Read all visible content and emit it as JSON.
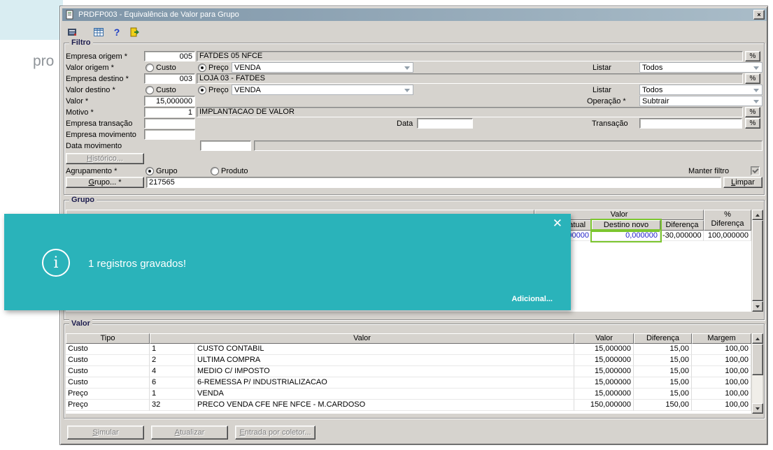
{
  "page": {
    "partial_text": "pro"
  },
  "window": {
    "title": "PRDFP003 - Equivalência de Valor para Grupo",
    "close_glyph": "×"
  },
  "icons": {
    "help_glyph": "?",
    "lookup_glyph": "%"
  },
  "colors": {
    "titlebar": "#7e95a8",
    "toast": "#2ab3ba",
    "highlight_green": "#7cc62f",
    "value_blue": "#2121c8"
  },
  "filtro": {
    "legend": "Filtro",
    "empresa_origem": {
      "label": "Empresa origem *",
      "code": "005",
      "desc": "FATDES 05 NFCE"
    },
    "valor_origem": {
      "label": "Valor origem *",
      "opt_custo": "Custo",
      "opt_preco": "Preço",
      "tipo": "VENDA",
      "listar_label": "Listar",
      "listar": "Todos"
    },
    "empresa_destino": {
      "label": "Empresa destino *",
      "code": "003",
      "desc": "LOJA 03 - FATDES"
    },
    "valor_destino": {
      "label": "Valor destino *",
      "opt_custo": "Custo",
      "opt_preco": "Preço",
      "tipo": "VENDA",
      "listar_label": "Listar",
      "listar": "Todos"
    },
    "valor": {
      "label": "Valor *",
      "value": "15,000000",
      "operacao_label": "Operação *",
      "operacao": "Subtrair"
    },
    "motivo": {
      "label": "Motivo *",
      "code": "1",
      "desc": "IMPLANTACAO DE VALOR"
    },
    "empresa_transacao": {
      "label": "Empresa transação",
      "code": "",
      "data_label": "Data",
      "data_value": "",
      "transacao_label": "Transação",
      "transacao_value": ""
    },
    "empresa_movimento": {
      "label": "Empresa movimento",
      "code": ""
    },
    "data_movimento": {
      "label": "Data movimento",
      "value": "",
      "aux": ""
    },
    "historico_button": "Histórico...",
    "agrupamento": {
      "label": "Agrupamento *",
      "opt_grupo": "Grupo",
      "opt_produto": "Produto",
      "manter_filtro_label": "Manter filtro"
    },
    "grupo_button": "Grupo... *",
    "grupo_value": "217565",
    "limpar_button": "Limpar"
  },
  "grupo": {
    "legend": "Grupo",
    "h_valor": "Valor",
    "h_pct_1": "%",
    "h_pct_2": "Diferença",
    "h_destino_atual": "Destino atual",
    "h_destino_novo": "Destino novo",
    "h_diferenca": "Diferença",
    "row": {
      "destino_atual": "30,000000",
      "destino_novo": "0,000000",
      "diferenca": "-30,000000",
      "pct_diferenca": "100,000000"
    }
  },
  "valor_grid": {
    "legend": "Valor",
    "headers": [
      "Tipo",
      "Valor",
      "Valor",
      "Diferença",
      "Margem"
    ],
    "rows": [
      [
        "Custo",
        "1",
        "CUSTO CONTABIL",
        "15,000000",
        "15,00",
        "100,00"
      ],
      [
        "Custo",
        "2",
        "ULTIMA COMPRA",
        "15,000000",
        "15,00",
        "100,00"
      ],
      [
        "Custo",
        "4",
        "MEDIO C/ IMPOSTO",
        "15,000000",
        "15,00",
        "100,00"
      ],
      [
        "Custo",
        "6",
        "6-REMESSA P/ INDUSTRIALIZACAO",
        "15,000000",
        "15,00",
        "100,00"
      ],
      [
        "Preço",
        "1",
        "VENDA",
        "15,000000",
        "15,00",
        "100,00"
      ],
      [
        "Preço",
        "32",
        "PRECO VENDA CFE NFE NFCE - M.CARDOSO",
        "150,000000",
        "150,00",
        "100,00"
      ]
    ]
  },
  "actions": {
    "simular": "Simular",
    "atualizar": "Atualizar",
    "entrada_coletor": "Entrada por coletor..."
  },
  "toast": {
    "message": "1 registros gravados!",
    "action": "Adicional...",
    "close_glyph": "✕",
    "info_glyph": "i"
  }
}
